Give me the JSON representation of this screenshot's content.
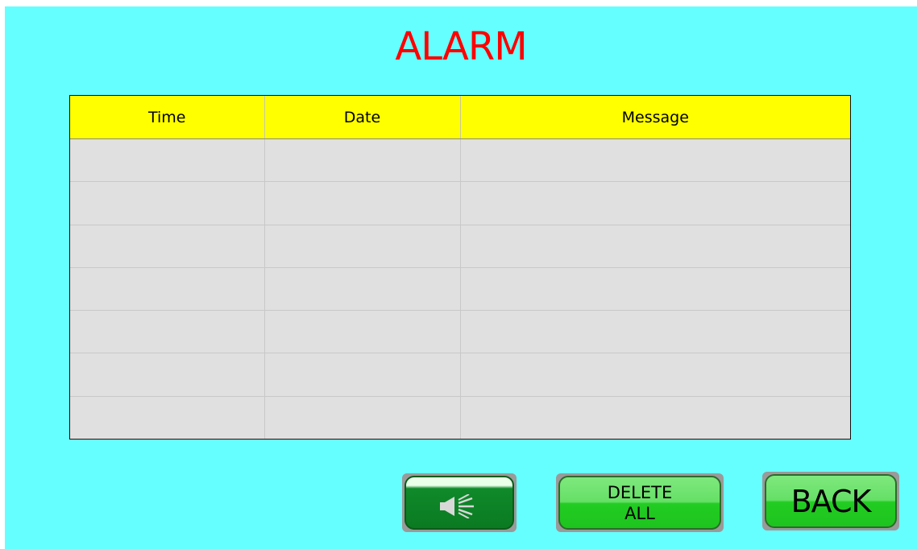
{
  "screen": {
    "title": "ALARM",
    "background_color": "#66ffff",
    "title_color": "#ff0000"
  },
  "alarm_table": {
    "header_color": "#ffff00",
    "columns": [
      "Time",
      "Date",
      "Message"
    ],
    "rows": [
      [
        "",
        "",
        ""
      ],
      [
        "",
        "",
        ""
      ],
      [
        "",
        "",
        ""
      ],
      [
        "",
        "",
        ""
      ],
      [
        "",
        "",
        ""
      ],
      [
        "",
        "",
        ""
      ],
      [
        "",
        "",
        ""
      ]
    ]
  },
  "buttons": {
    "mute": {
      "icon": "speaker-icon"
    },
    "delete_all": {
      "line1": "DELETE",
      "line2": "ALL"
    },
    "back": {
      "label": "BACK"
    }
  }
}
